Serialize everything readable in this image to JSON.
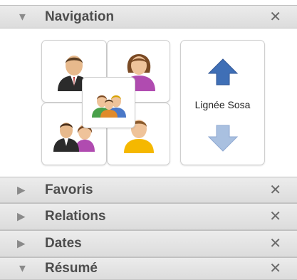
{
  "panels": {
    "navigation": {
      "title": "Navigation",
      "close": "✕",
      "expanded": true
    },
    "favoris": {
      "title": "Favoris",
      "close": "✕",
      "expanded": false
    },
    "relations": {
      "title": "Relations",
      "close": "✕",
      "expanded": false
    },
    "dates": {
      "title": "Dates",
      "close": "✕",
      "expanded": false
    },
    "resume": {
      "title": "Résumé",
      "close": "✕",
      "expanded": true
    }
  },
  "navigation": {
    "sosa_label": "Lignée Sosa",
    "icons": {
      "father": "male-person-icon",
      "mother": "female-person-icon",
      "family": "family-group-icon",
      "spouse": "couple-icon",
      "child": "child-person-icon",
      "up": "arrow-up-icon",
      "down": "arrow-down-icon"
    }
  },
  "colors": {
    "arrow_active": "#3f6fb6",
    "arrow_inactive": "#a9c0e0",
    "header_text": "#4d4d4d"
  }
}
